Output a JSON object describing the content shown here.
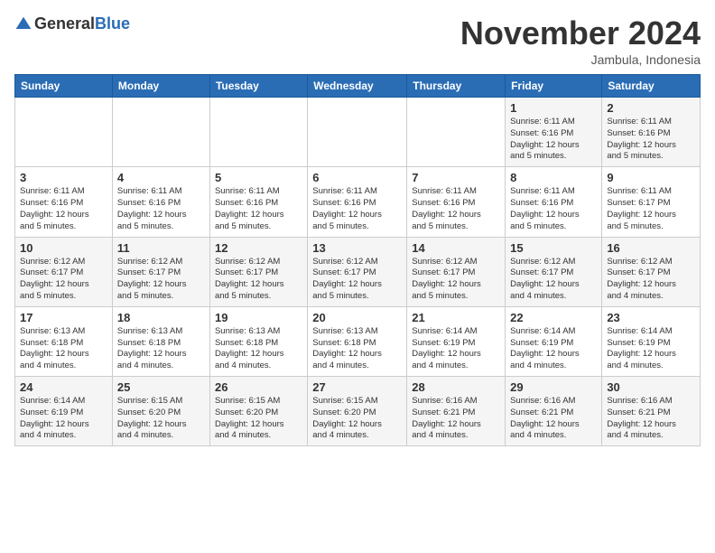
{
  "logo": {
    "general": "General",
    "blue": "Blue"
  },
  "title": "November 2024",
  "location": "Jambula, Indonesia",
  "weekdays": [
    "Sunday",
    "Monday",
    "Tuesday",
    "Wednesday",
    "Thursday",
    "Friday",
    "Saturday"
  ],
  "weeks": [
    [
      {
        "day": "",
        "info": ""
      },
      {
        "day": "",
        "info": ""
      },
      {
        "day": "",
        "info": ""
      },
      {
        "day": "",
        "info": ""
      },
      {
        "day": "",
        "info": ""
      },
      {
        "day": "1",
        "info": "Sunrise: 6:11 AM\nSunset: 6:16 PM\nDaylight: 12 hours\nand 5 minutes."
      },
      {
        "day": "2",
        "info": "Sunrise: 6:11 AM\nSunset: 6:16 PM\nDaylight: 12 hours\nand 5 minutes."
      }
    ],
    [
      {
        "day": "3",
        "info": "Sunrise: 6:11 AM\nSunset: 6:16 PM\nDaylight: 12 hours\nand 5 minutes."
      },
      {
        "day": "4",
        "info": "Sunrise: 6:11 AM\nSunset: 6:16 PM\nDaylight: 12 hours\nand 5 minutes."
      },
      {
        "day": "5",
        "info": "Sunrise: 6:11 AM\nSunset: 6:16 PM\nDaylight: 12 hours\nand 5 minutes."
      },
      {
        "day": "6",
        "info": "Sunrise: 6:11 AM\nSunset: 6:16 PM\nDaylight: 12 hours\nand 5 minutes."
      },
      {
        "day": "7",
        "info": "Sunrise: 6:11 AM\nSunset: 6:16 PM\nDaylight: 12 hours\nand 5 minutes."
      },
      {
        "day": "8",
        "info": "Sunrise: 6:11 AM\nSunset: 6:16 PM\nDaylight: 12 hours\nand 5 minutes."
      },
      {
        "day": "9",
        "info": "Sunrise: 6:11 AM\nSunset: 6:17 PM\nDaylight: 12 hours\nand 5 minutes."
      }
    ],
    [
      {
        "day": "10",
        "info": "Sunrise: 6:12 AM\nSunset: 6:17 PM\nDaylight: 12 hours\nand 5 minutes."
      },
      {
        "day": "11",
        "info": "Sunrise: 6:12 AM\nSunset: 6:17 PM\nDaylight: 12 hours\nand 5 minutes."
      },
      {
        "day": "12",
        "info": "Sunrise: 6:12 AM\nSunset: 6:17 PM\nDaylight: 12 hours\nand 5 minutes."
      },
      {
        "day": "13",
        "info": "Sunrise: 6:12 AM\nSunset: 6:17 PM\nDaylight: 12 hours\nand 5 minutes."
      },
      {
        "day": "14",
        "info": "Sunrise: 6:12 AM\nSunset: 6:17 PM\nDaylight: 12 hours\nand 5 minutes."
      },
      {
        "day": "15",
        "info": "Sunrise: 6:12 AM\nSunset: 6:17 PM\nDaylight: 12 hours\nand 4 minutes."
      },
      {
        "day": "16",
        "info": "Sunrise: 6:12 AM\nSunset: 6:17 PM\nDaylight: 12 hours\nand 4 minutes."
      }
    ],
    [
      {
        "day": "17",
        "info": "Sunrise: 6:13 AM\nSunset: 6:18 PM\nDaylight: 12 hours\nand 4 minutes."
      },
      {
        "day": "18",
        "info": "Sunrise: 6:13 AM\nSunset: 6:18 PM\nDaylight: 12 hours\nand 4 minutes."
      },
      {
        "day": "19",
        "info": "Sunrise: 6:13 AM\nSunset: 6:18 PM\nDaylight: 12 hours\nand 4 minutes."
      },
      {
        "day": "20",
        "info": "Sunrise: 6:13 AM\nSunset: 6:18 PM\nDaylight: 12 hours\nand 4 minutes."
      },
      {
        "day": "21",
        "info": "Sunrise: 6:14 AM\nSunset: 6:19 PM\nDaylight: 12 hours\nand 4 minutes."
      },
      {
        "day": "22",
        "info": "Sunrise: 6:14 AM\nSunset: 6:19 PM\nDaylight: 12 hours\nand 4 minutes."
      },
      {
        "day": "23",
        "info": "Sunrise: 6:14 AM\nSunset: 6:19 PM\nDaylight: 12 hours\nand 4 minutes."
      }
    ],
    [
      {
        "day": "24",
        "info": "Sunrise: 6:14 AM\nSunset: 6:19 PM\nDaylight: 12 hours\nand 4 minutes."
      },
      {
        "day": "25",
        "info": "Sunrise: 6:15 AM\nSunset: 6:20 PM\nDaylight: 12 hours\nand 4 minutes."
      },
      {
        "day": "26",
        "info": "Sunrise: 6:15 AM\nSunset: 6:20 PM\nDaylight: 12 hours\nand 4 minutes."
      },
      {
        "day": "27",
        "info": "Sunrise: 6:15 AM\nSunset: 6:20 PM\nDaylight: 12 hours\nand 4 minutes."
      },
      {
        "day": "28",
        "info": "Sunrise: 6:16 AM\nSunset: 6:21 PM\nDaylight: 12 hours\nand 4 minutes."
      },
      {
        "day": "29",
        "info": "Sunrise: 6:16 AM\nSunset: 6:21 PM\nDaylight: 12 hours\nand 4 minutes."
      },
      {
        "day": "30",
        "info": "Sunrise: 6:16 AM\nSunset: 6:21 PM\nDaylight: 12 hours\nand 4 minutes."
      }
    ]
  ]
}
